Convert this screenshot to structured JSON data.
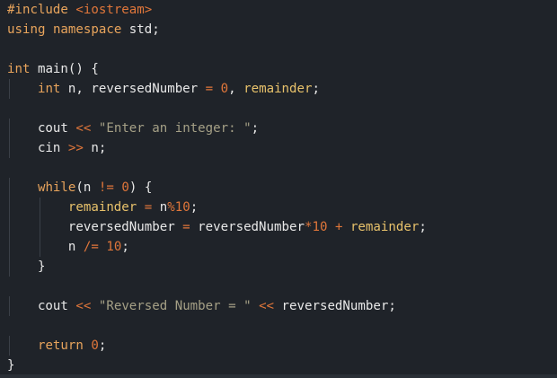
{
  "code": {
    "lines": [
      {
        "t": "#include",
        "c": "pp",
        "t2": " ",
        "c2": "plain",
        "t3": "<iostream>",
        "c3": "hdr"
      },
      {
        "tokens": [
          [
            "using",
            "kw"
          ],
          [
            " ",
            "plain"
          ],
          [
            "namespace",
            "kw"
          ],
          [
            " std;",
            "plain"
          ]
        ]
      },
      {
        "tokens": []
      },
      {
        "tokens": [
          [
            "int",
            "type"
          ],
          [
            " main() {",
            "plain"
          ]
        ]
      },
      {
        "tokens": [
          [
            "    ",
            "plain"
          ],
          [
            "int",
            "type"
          ],
          [
            " n, reversedNumber ",
            "plain"
          ],
          [
            "=",
            "op"
          ],
          [
            " ",
            "plain"
          ],
          [
            "0",
            "num"
          ],
          [
            ", ",
            "plain"
          ],
          [
            "remainder",
            "var"
          ],
          [
            ";",
            "plain"
          ]
        ]
      },
      {
        "tokens": []
      },
      {
        "tokens": [
          [
            "    cout ",
            "plain"
          ],
          [
            "<<",
            "op"
          ],
          [
            " ",
            "plain"
          ],
          [
            "\"Enter an integer: \"",
            "str"
          ],
          [
            ";",
            "plain"
          ]
        ]
      },
      {
        "tokens": [
          [
            "    cin ",
            "plain"
          ],
          [
            ">>",
            "op"
          ],
          [
            " n;",
            "plain"
          ]
        ]
      },
      {
        "tokens": []
      },
      {
        "tokens": [
          [
            "    ",
            "plain"
          ],
          [
            "while",
            "ctrl"
          ],
          [
            "(n ",
            "plain"
          ],
          [
            "!=",
            "op"
          ],
          [
            " ",
            "plain"
          ],
          [
            "0",
            "num"
          ],
          [
            ") {",
            "plain"
          ]
        ]
      },
      {
        "tokens": [
          [
            "        ",
            "plain"
          ],
          [
            "remainder",
            "var"
          ],
          [
            " ",
            "plain"
          ],
          [
            "=",
            "op"
          ],
          [
            " n",
            "plain"
          ],
          [
            "%",
            "op"
          ],
          [
            "10",
            "num"
          ],
          [
            ";",
            "plain"
          ]
        ]
      },
      {
        "tokens": [
          [
            "        reversedNumber ",
            "plain"
          ],
          [
            "=",
            "op"
          ],
          [
            " reversedNumber",
            "plain"
          ],
          [
            "*",
            "op"
          ],
          [
            "10",
            "num"
          ],
          [
            " ",
            "plain"
          ],
          [
            "+",
            "op"
          ],
          [
            " ",
            "plain"
          ],
          [
            "remainder",
            "var"
          ],
          [
            ";",
            "plain"
          ]
        ]
      },
      {
        "tokens": [
          [
            "        n ",
            "plain"
          ],
          [
            "/=",
            "op"
          ],
          [
            " ",
            "plain"
          ],
          [
            "10",
            "num"
          ],
          [
            ";",
            "plain"
          ]
        ]
      },
      {
        "tokens": [
          [
            "    }",
            "plain"
          ]
        ]
      },
      {
        "tokens": []
      },
      {
        "tokens": [
          [
            "    cout ",
            "plain"
          ],
          [
            "<<",
            "op"
          ],
          [
            " ",
            "plain"
          ],
          [
            "\"Reversed Number = \"",
            "str"
          ],
          [
            " ",
            "plain"
          ],
          [
            "<<",
            "op"
          ],
          [
            " reversedNumber;",
            "plain"
          ]
        ]
      },
      {
        "tokens": []
      },
      {
        "tokens": [
          [
            "    ",
            "plain"
          ],
          [
            "return",
            "ctrl"
          ],
          [
            " ",
            "plain"
          ],
          [
            "0",
            "num"
          ],
          [
            ";",
            "plain"
          ]
        ]
      },
      {
        "tokens": [
          [
            "}",
            "plain"
          ]
        ]
      }
    ]
  },
  "colors": {
    "background": "#1f2329",
    "keyword": "#e8a45c",
    "string": "#a5a086",
    "number": "#e0763a",
    "variable": "#e8c26b",
    "text": "#e8e8e8"
  }
}
